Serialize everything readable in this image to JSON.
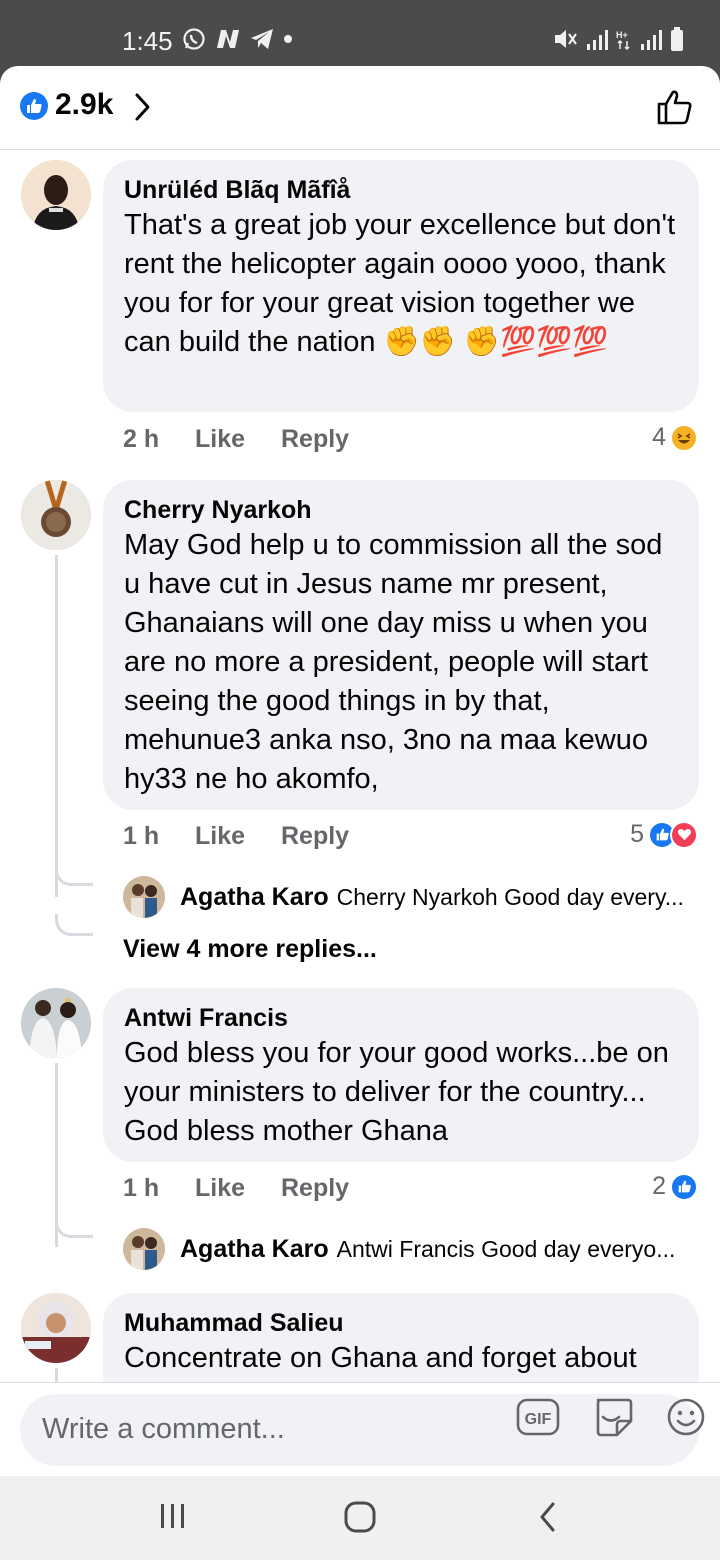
{
  "status": {
    "time": "1:45"
  },
  "header": {
    "like_count": "2.9k"
  },
  "comments": [
    {
      "author": "Unrüléd Blãq Mãfîå",
      "text": "That's a great job your excellence but don't rent the helicopter again oooo yooo, thank you for for your great vision together we can build the nation ✊✊ ✊💯💯💯",
      "time": "2 h",
      "like": "Like",
      "reply": "Reply",
      "reactions": "4"
    },
    {
      "author": "Cherry Nyarkoh",
      "text": "May God help u to commission all the sod u have cut in Jesus name mr present, Ghanaians will one day miss u when you are no more a president, people will start seeing the good things in by that, mehunue3 anka nso, 3no na maa kewuo hy33 ne ho akomfo,",
      "time": "1 h",
      "like": "Like",
      "reply": "Reply",
      "reactions": "5",
      "reply_preview": {
        "name": "Agatha Karo",
        "text": "Cherry Nyarkoh Good day every..."
      },
      "more_replies": "View 4 more replies..."
    },
    {
      "author": "Antwi Francis",
      "text": "God bless you for your good works...be on your ministers to deliver for the country... God bless mother Ghana",
      "time": "1 h",
      "like": "Like",
      "reply": "Reply",
      "reactions": "2",
      "reply_preview": {
        "name": "Agatha Karo",
        "text": "Antwi Francis Good day everyo..."
      }
    },
    {
      "author": "Muhammad Salieu",
      "text": "Concentrate on Ghana and forget about"
    }
  ],
  "composer": {
    "placeholder": "Write a comment...",
    "gif_label": "GIF"
  },
  "colors": {
    "accent": "#1877f2",
    "love": "#f33e58",
    "haha": "#f7b125"
  }
}
